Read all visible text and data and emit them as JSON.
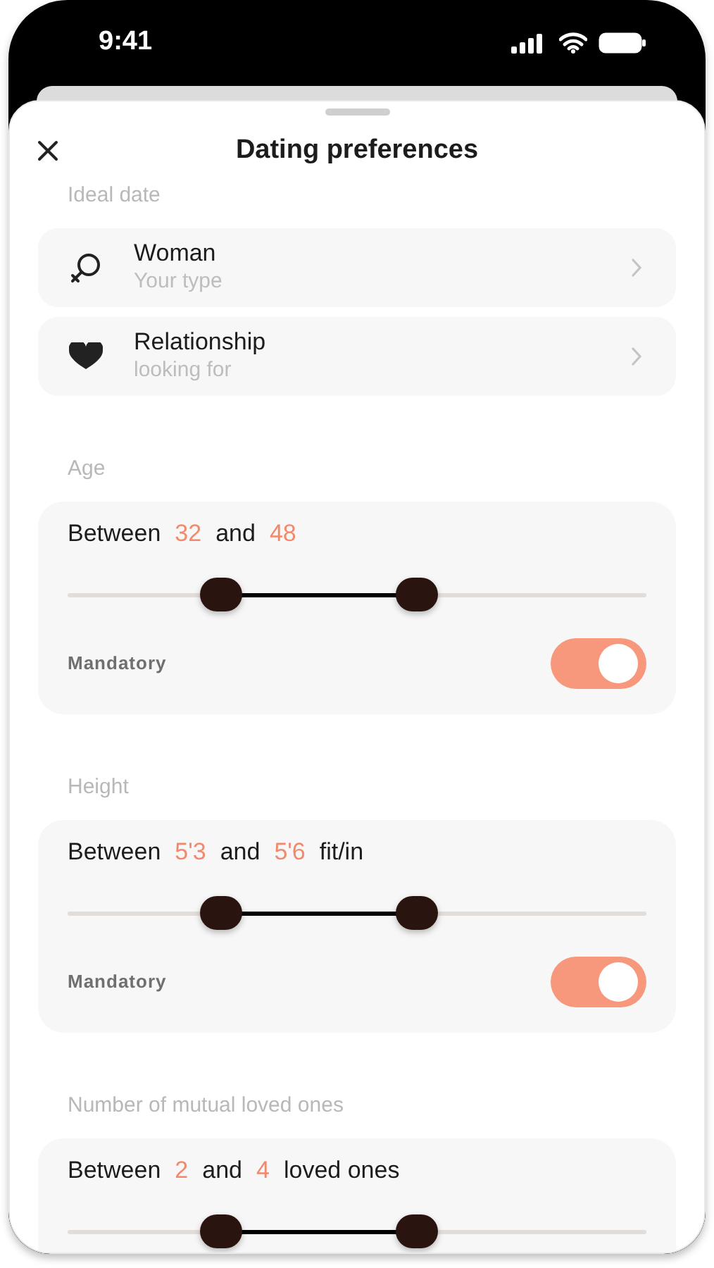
{
  "status_bar": {
    "time": "9:41"
  },
  "sheet": {
    "title": "Dating preferences"
  },
  "sections": [
    {
      "kind": "list",
      "label": "Ideal date",
      "items": [
        {
          "kind": "gender",
          "title": "Woman",
          "subtitle": "Your type"
        },
        {
          "kind": "relationship",
          "title": "Relationship",
          "subtitle": "looking for"
        }
      ]
    },
    {
      "kind": "range",
      "label": "Age",
      "summary": [
        {
          "kind": "text",
          "text": "Between"
        },
        {
          "kind": "value",
          "text": "32"
        },
        {
          "kind": "text",
          "text": "and"
        },
        {
          "kind": "value",
          "text": "48"
        }
      ],
      "thumbs": [
        {
          "level": 0.266
        },
        {
          "level": 0.604
        }
      ],
      "mandatory": {
        "label": "Mandatory",
        "on": true
      }
    },
    {
      "kind": "range",
      "label": "Height",
      "summary": [
        {
          "kind": "text",
          "text": "Between"
        },
        {
          "kind": "value",
          "text": "5'3"
        },
        {
          "kind": "text",
          "text": "and"
        },
        {
          "kind": "value",
          "text": "5'6"
        },
        {
          "kind": "text",
          "text": "fit/in"
        }
      ],
      "thumbs": [
        {
          "level": 0.266
        },
        {
          "level": 0.604
        }
      ],
      "mandatory": {
        "label": "Mandatory",
        "on": true
      }
    },
    {
      "kind": "range",
      "label": "Number of mutual loved ones",
      "summary": [
        {
          "kind": "text",
          "text": "Between"
        },
        {
          "kind": "value",
          "text": "2"
        },
        {
          "kind": "text",
          "text": "and"
        },
        {
          "kind": "value",
          "text": "4"
        },
        {
          "kind": "text",
          "text": "loved ones"
        }
      ],
      "thumbs": [
        {
          "level": 0.266
        },
        {
          "level": 0.604
        }
      ]
    }
  ]
}
